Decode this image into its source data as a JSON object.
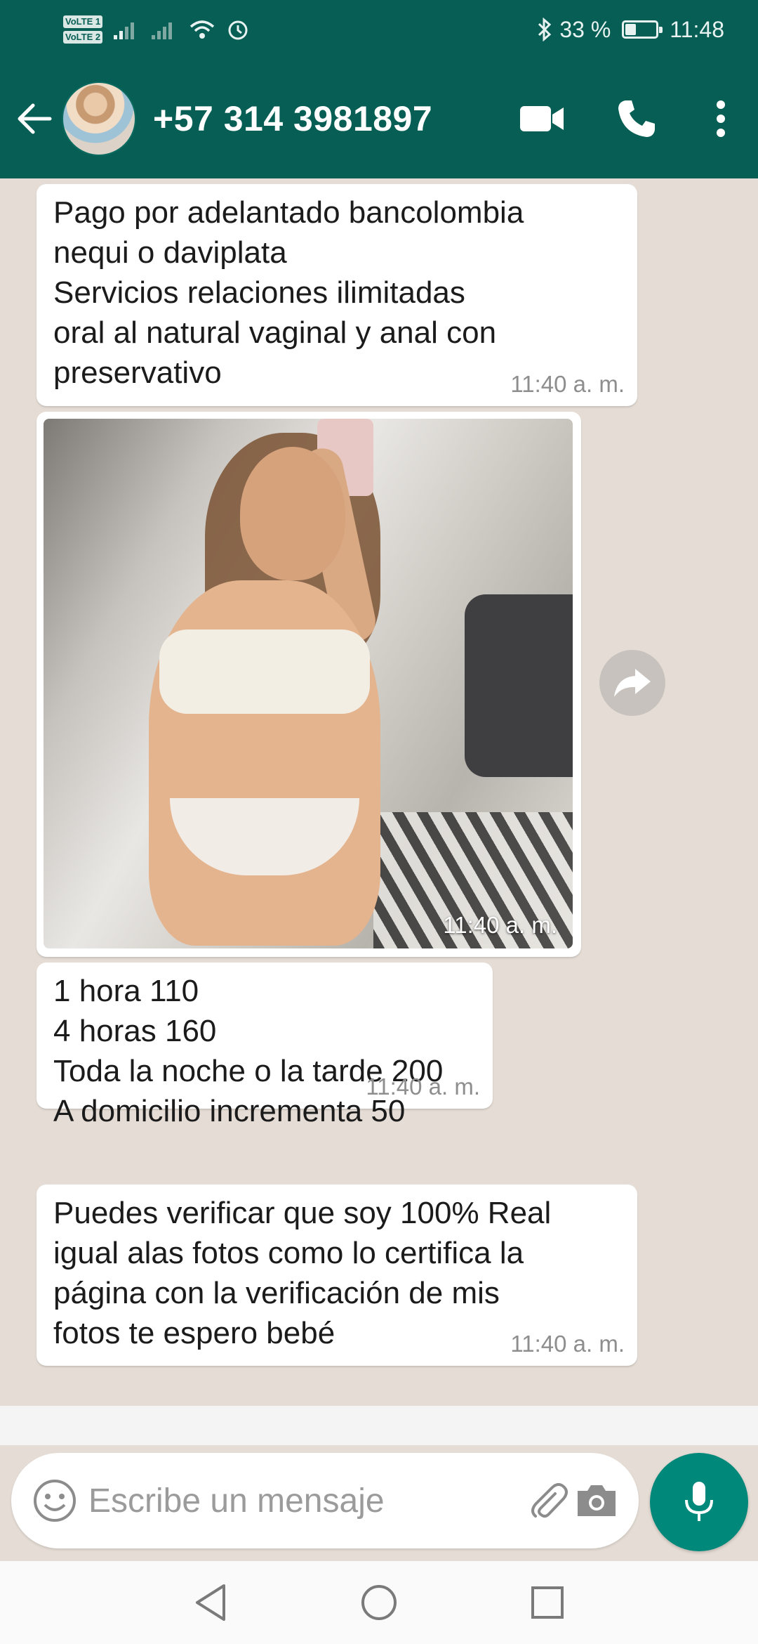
{
  "status_bar": {
    "volte_1": "VoLTE 1",
    "volte_2": "VoLTE 2",
    "battery_percent": "33 %",
    "battery_level": 0.33,
    "time": "11:48"
  },
  "header": {
    "contact_name": "+57 314 3981897",
    "icons": [
      "back-arrow-icon",
      "video-call-icon",
      "phone-icon",
      "more-vert-icon"
    ]
  },
  "messages": [
    {
      "type": "text",
      "text": "Pago por adelantado bancolombia\nnequi o daviplata\nServicios relaciones ilimitadas\noral al natural vaginal y anal con\npreservativo",
      "time": "11:40 a. m."
    },
    {
      "type": "image",
      "time": "11:40 a. m."
    },
    {
      "type": "text",
      "text": "1 hora 110\n4 horas 160\nToda la noche o la tarde 200\nA domicilio incrementa 50",
      "time": "11:40 a. m."
    },
    {
      "type": "text",
      "text": "Puedes verificar que soy 100% Real\nigual alas fotos como lo certifica la\npágina con la verificación de mis\nfotos te espero bebé",
      "time": "11:40 a. m."
    }
  ],
  "composer": {
    "placeholder": "Escribe un mensaje",
    "icons": [
      "emoji-icon",
      "attach-icon",
      "camera-icon",
      "mic-icon"
    ]
  },
  "colors": {
    "header": "#075e54",
    "chat_background": "#e5ddd5",
    "bubble": "#ffffff",
    "mic_button": "#00897b"
  }
}
